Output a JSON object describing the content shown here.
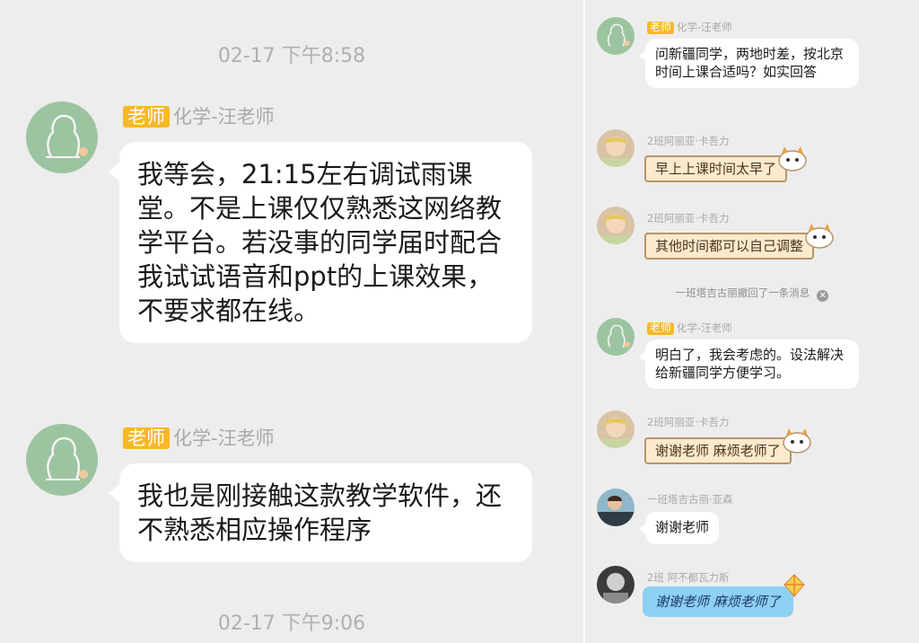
{
  "left": {
    "timestamp_top": "02-17 下午8:58",
    "messages": [
      {
        "tag": "老师",
        "sender": "化学-汪老师",
        "text": "我等会，21:15左右调试雨课堂。不是上课仅仅熟悉这网络教学平台。若没事的同学届时配合我试试语音和ppt的上课效果，不要求都在线。"
      },
      {
        "tag": "老师",
        "sender": "化学-汪老师",
        "text": "我也是刚接触这款教学软件，还不熟悉相应操作程序"
      }
    ],
    "timestamp_bottom": "02-17 下午9:06"
  },
  "right": {
    "msg1": {
      "tag": "老师",
      "sender": "化学-汪老师",
      "text": "问新疆同学，两地时差，按北京时间上课合适吗？如实回答"
    },
    "msg2": {
      "sender": "2班阿丽亚·卡吾力",
      "text": "早上上课时间太早了"
    },
    "msg3": {
      "sender": "2班阿丽亚·卡吾力",
      "text": "其他时间都可以自己调整"
    },
    "recall": "一班塔吉古丽撤回了一条消息",
    "msg4": {
      "tag": "老师",
      "sender": "化学-汪老师",
      "text": "明白了，我会考虑的。设法解决给新疆同学方便学习。"
    },
    "msg5": {
      "sender": "2班阿丽亚·卡吾力",
      "text": "谢谢老师 麻烦老师了"
    },
    "msg6": {
      "sender": "一班塔吉古丽·亚森",
      "text": "谢谢老师"
    },
    "msg7": {
      "sender": "2班 阿不都瓦力斯",
      "text": "谢谢老师 麻烦老师了"
    }
  },
  "icons": {
    "teacher_avatar": "teacher-silhouette-avatar",
    "student_avatar": "student-photo-avatar",
    "close": "close-icon"
  }
}
